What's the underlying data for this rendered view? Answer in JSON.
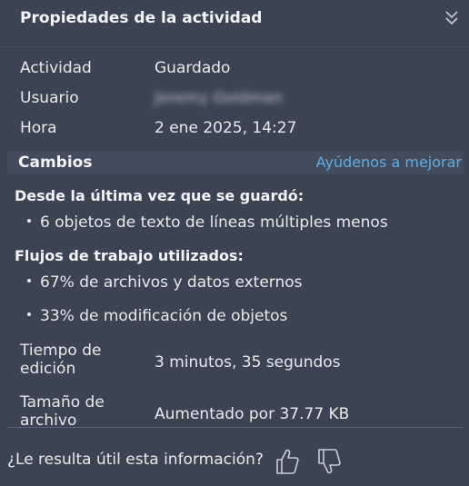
{
  "header": {
    "title": "Propiedades de la actividad",
    "collapse_icon": "double-chevron-down-icon"
  },
  "properties": {
    "activity_label": "Actividad",
    "activity_value": "Guardado",
    "user_label": "Usuario",
    "user_value": "Jeremy Goldman",
    "time_label": "Hora",
    "time_value": "2 ene 2025, 14:27"
  },
  "changes": {
    "title": "Cambios",
    "help_link": "Ayúdenos a mejorar",
    "since_last_save_heading": "Desde la última vez que se guardó:",
    "since_last_save_items": [
      "6 objetos de texto de líneas múltiples menos"
    ],
    "workflows_heading": "Flujos de trabajo utilizados:",
    "workflows_items": [
      "67% de archivos y datos externos",
      "33% de modificación de objetos"
    ],
    "edit_time_label_line1": "Tiempo de",
    "edit_time_label_line2": "edición",
    "edit_time_value": "3 minutos, 35 segundos",
    "file_size_label_line1": "Tamaño de",
    "file_size_label_line2": "archivo",
    "file_size_value": "Aumentado por 37.77 KB"
  },
  "feedback": {
    "question": "¿Le resulta útil esta información?",
    "thumbs_up_icon": "thumbs-up-icon",
    "thumbs_down_icon": "thumbs-down-icon"
  },
  "colors": {
    "background": "#3b4453",
    "section_bar": "#434c5c",
    "link": "#5aaeea",
    "text": "#e8eaed"
  }
}
